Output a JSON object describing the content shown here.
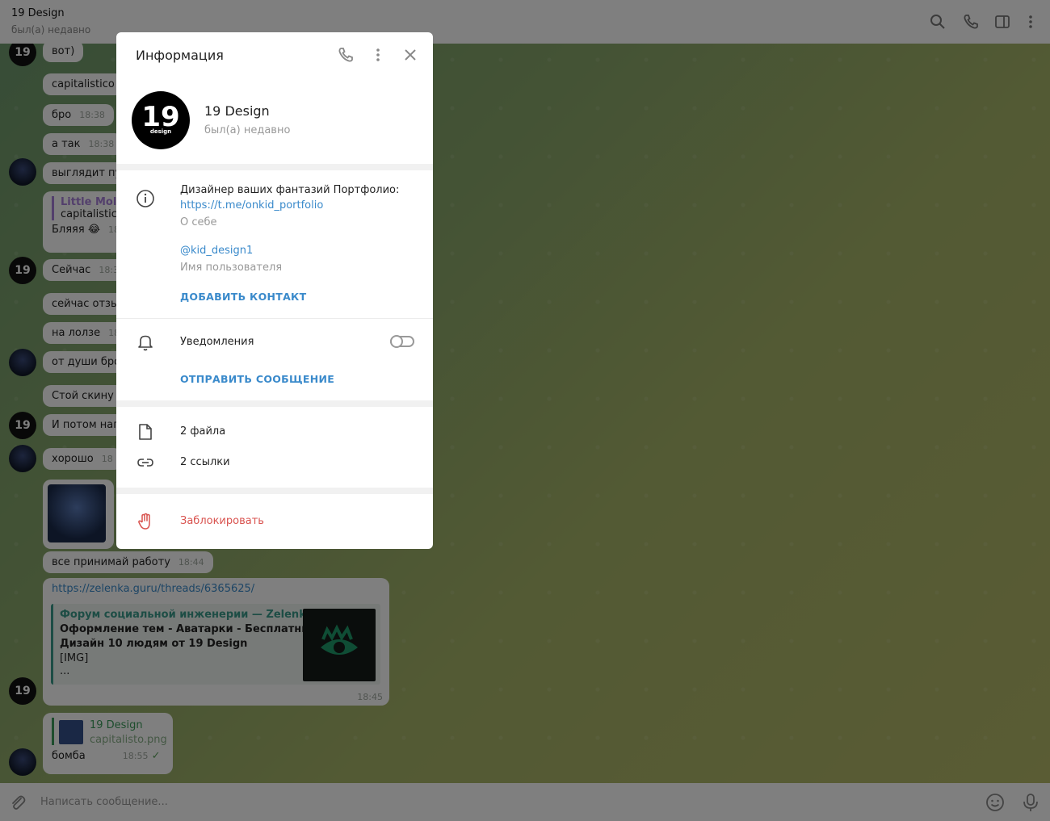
{
  "header": {
    "title": "19 Design",
    "status": "был(а) недавно"
  },
  "chat": {
    "messages": [
      {
        "text": "вот)",
        "time": ""
      },
      {
        "text": "capitalistico",
        "time": ""
      },
      {
        "text": "бро",
        "time": "18:38"
      },
      {
        "text": "а так",
        "time": "18:38"
      },
      {
        "text": "выглядит пуц",
        "time": ""
      },
      {
        "reply_name": "Little Molni",
        "reply_text": "capitalistico",
        "text": "Бляяя",
        "time": "18"
      },
      {
        "text": "Сейчас",
        "time": "18:3"
      },
      {
        "text": "сейчас отзыв",
        "time": ""
      },
      {
        "text": "на лолзе",
        "time": "18"
      },
      {
        "text": "от души бро",
        "time": ""
      },
      {
        "text": "Стой скину с",
        "time": ""
      },
      {
        "text": "И потом нап",
        "time": ""
      },
      {
        "text": "хорошо",
        "time": "18"
      },
      {
        "text": "все принимай работу",
        "time": "18:44"
      }
    ],
    "link_message": {
      "url": "https://zelenka.guru/threads/6365625/",
      "site": "Форум социальной инженерии — Zelenka....",
      "line1": "Оформление тем - Аватарки - Бесплатный",
      "line2": "Дизайн 10 людям от 19 Design",
      "line3": "[IMG]",
      "line4": "...",
      "time": "18:45"
    },
    "last_message": {
      "reply_name": "19 Design",
      "reply_file": "capitalisto.png",
      "text": "бомба",
      "time": "18:55"
    }
  },
  "composer": {
    "placeholder": "Написать сообщение..."
  },
  "dialog": {
    "title": "Информация",
    "name": "19 Design",
    "status": "был(а) недавно",
    "avatar_number": "19",
    "avatar_word": "design",
    "bio": "Дизайнер ваших фантазий Портфолио:",
    "bio_link": "https://t.me/onkid_portfolio",
    "bio_label": "О себе",
    "username": "@kid_design1",
    "username_label": "Имя пользователя",
    "add_contact": "ДОБАВИТЬ КОНТАКТ",
    "notifications": "Уведомления",
    "send_message": "ОТПРАВИТЬ СООБЩЕНИЕ",
    "files": "2 файла",
    "links": "2 ссылки",
    "block": "Заблокировать"
  },
  "colors": {
    "accent": "#3a8acb",
    "danger": "#d9534f"
  }
}
